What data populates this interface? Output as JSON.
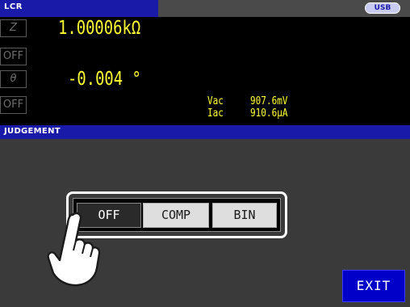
{
  "header": {
    "mode_label": "LCR",
    "usb_label": "USB"
  },
  "measurement": {
    "param1": {
      "name": "Z",
      "state": "OFF",
      "value": "1.00006kΩ"
    },
    "param2": {
      "name": "θ",
      "state": "OFF",
      "value": "-0.004 °"
    },
    "monitor": {
      "vac_label": "Vac",
      "vac_value": "907.6mV",
      "iac_label": "Iac",
      "iac_value": "910.6μA"
    }
  },
  "judgement": {
    "section_label": "JUDGEMENT",
    "options": [
      "OFF",
      "COMP",
      "BIN"
    ],
    "selected": "OFF"
  },
  "footer": {
    "exit_label": "EXIT"
  },
  "colors": {
    "header_blue": "#1a1aa8",
    "value_yellow": "#ffff33",
    "exit_blue": "#0000c8"
  }
}
